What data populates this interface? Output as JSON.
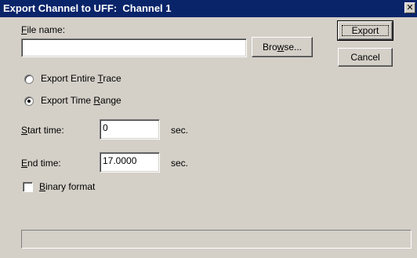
{
  "window": {
    "title": "Export Channel to UFF:  Channel 1",
    "close_glyph": "✕"
  },
  "file": {
    "label_prefix": "",
    "label_hotkey": "F",
    "label_rest": "ile name:",
    "value": "",
    "browse_prefix": "Bro",
    "browse_hotkey": "w",
    "browse_rest": "se..."
  },
  "buttons": {
    "export": "Export",
    "cancel": "Cancel"
  },
  "mode": {
    "entire_prefix": "Export Entire ",
    "entire_hotkey": "T",
    "entire_rest": "race",
    "range_prefix": "Export Time ",
    "range_hotkey": "R",
    "range_rest": "ange",
    "selected": "range"
  },
  "start": {
    "label_hotkey": "S",
    "label_rest": "tart time:",
    "value": "0",
    "unit": "sec."
  },
  "end": {
    "label_hotkey": "E",
    "label_rest": "nd time:",
    "value": "17.0000",
    "unit": "sec."
  },
  "binary": {
    "label_hotkey": "B",
    "label_rest": "inary format",
    "checked": false
  }
}
